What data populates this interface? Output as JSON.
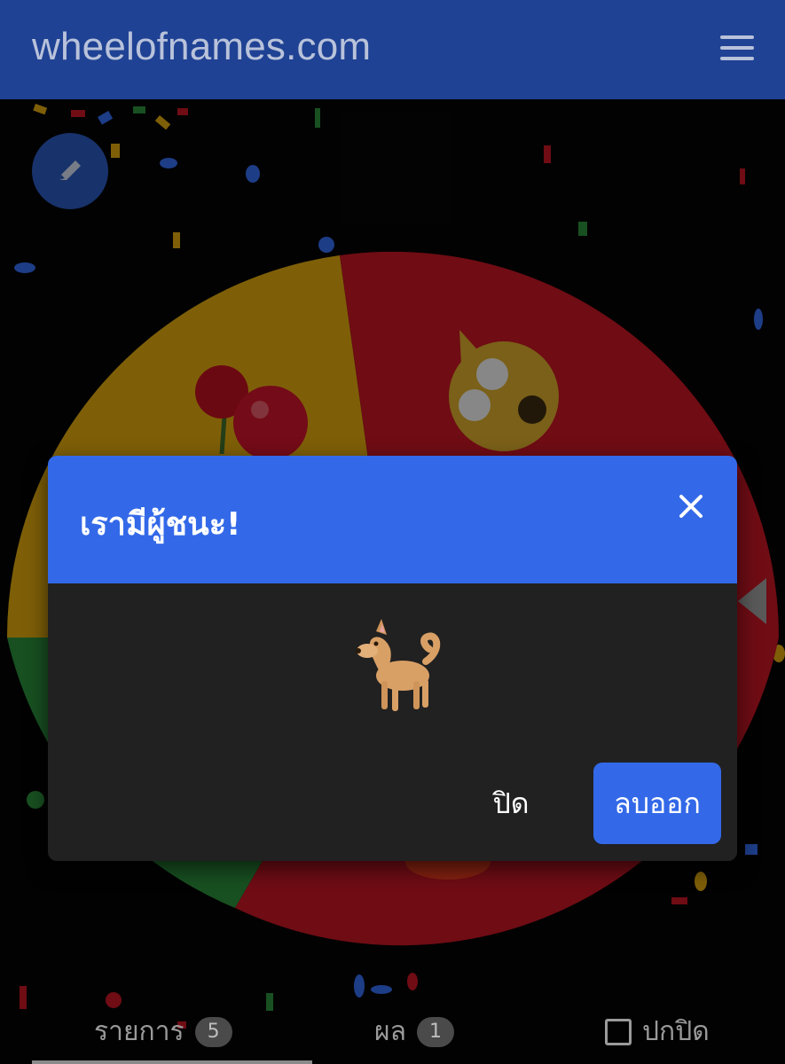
{
  "header": {
    "brand": "wheelofnames.com",
    "menu_icon": "hamburger-menu-icon"
  },
  "wheel": {
    "segment_colors": [
      "#d9a40f",
      "#c01524",
      "#2a8a3a",
      "#c01524"
    ]
  },
  "dialog": {
    "title": "เรามีผู้ชนะ!",
    "winner_icon": "dog-emoji",
    "close_button": "ปิด",
    "remove_button": "ลบออก"
  },
  "tabs": {
    "entries_label": "รายการ",
    "entries_count": "5",
    "results_label": "ผล",
    "results_count": "1",
    "hide_label": "ปกปิด"
  },
  "colors": {
    "header_bg": "#1f4294",
    "accent": "#3369e8",
    "dialog_bg": "#212121"
  }
}
